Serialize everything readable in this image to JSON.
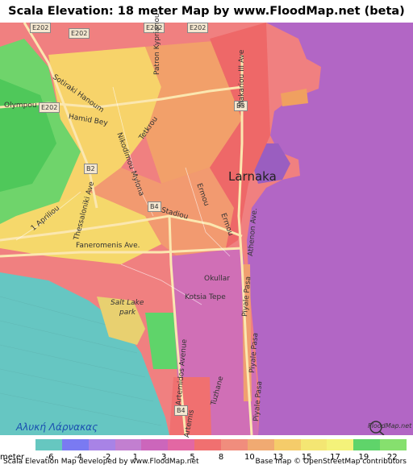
{
  "title": "Scala Elevation: 18 meter Map by www.FloodMap.net (beta)",
  "map": {
    "city_label": "Larnaka",
    "bay_label": "Αλυκή Λάρνακας",
    "roads": [
      "E202",
      "E202",
      "E202",
      "E202",
      "E202",
      "Patron Kyprianou",
      "Makariou III Ave",
      "Sotiraki Hanoum",
      "Hamid Bey",
      "Olympou",
      "Nikodimou Mylona",
      "Tetkrou",
      "B2",
      "B3",
      "B4",
      "B4",
      "Ermou",
      "Ermou",
      "1 Apriliou",
      "Thessaloniki Ave",
      "Stadiou",
      "Faneromenis Ave.",
      "Athenon Ave.",
      "Okullar",
      "Kotsia Tepe",
      "Salt Lake",
      "park",
      "Piyale Pasa",
      "Piyale Pasa",
      "Piyale Pasa",
      "Artemidos Avenue",
      "Tuzhane",
      "Artemis"
    ],
    "colors": {
      "sea": "#b266c5",
      "salt_lake": "#66c6c2",
      "high_green": "#5dd664",
      "yellow": "#f7d86a",
      "orange": "#f79a66",
      "red": "#f06d6d"
    }
  },
  "legend": {
    "unit_label": "meter",
    "ticks": [
      "-6",
      "-4",
      "-2",
      "1",
      "3",
      "5",
      "8",
      "10",
      "13",
      "15",
      "17",
      "19",
      "22"
    ],
    "colors": [
      "#66c7c0",
      "#7a7af2",
      "#a883e6",
      "#c27fd0",
      "#cc66bb",
      "#e367a3",
      "#f07070",
      "#f08d7d",
      "#f0aa72",
      "#f5cc6a",
      "#f4e673",
      "#f4f27a",
      "#5fd46a",
      "#86e06e"
    ]
  },
  "footer": {
    "left": "Scala Elevation Map developed by www.FloodMap.net",
    "right": "Base map © OpenStreetMap contributors"
  },
  "logo_text": "FloodMap.net"
}
